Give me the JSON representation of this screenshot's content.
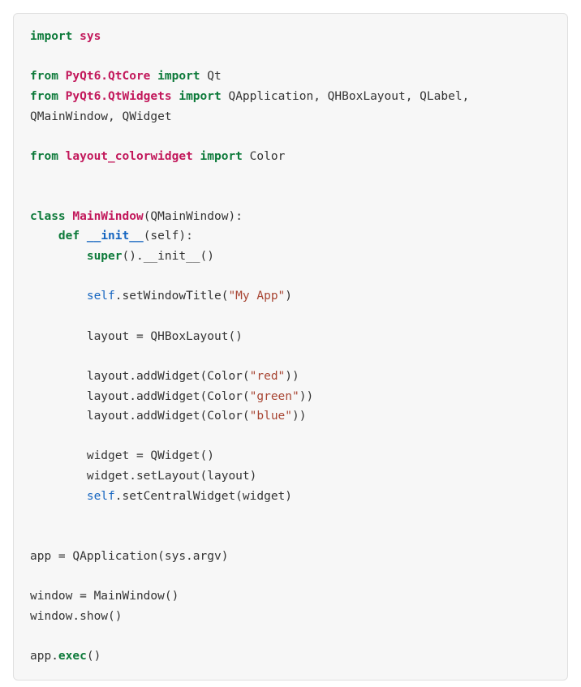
{
  "code": {
    "t01a": "import",
    "t01b": "sys",
    "t03a": "from",
    "t03b": "PyQt6.QtCore",
    "t03c": "import",
    "t03d": "Qt",
    "t04a": "from",
    "t04b": "PyQt6.QtWidgets",
    "t04c": "import",
    "t04d": "QApplication, QHBoxLayout, QLabel,",
    "t05a": "QMainWindow, QWidget",
    "t07a": "from",
    "t07b": "layout_colorwidget",
    "t07c": "import",
    "t07d": "Color",
    "t10a": "class",
    "t10b": "MainWindow",
    "t10c": "(QMainWindow):",
    "t11a": "def",
    "t11b": "__init__",
    "t11c": "(self):",
    "t12a": "super",
    "t12b": "().__init__()",
    "t14a": "self",
    "t14b": ".setWindowTitle(",
    "t14c": "\"My App\"",
    "t14d": ")",
    "t16a": "layout = QHBoxLayout()",
    "t18a": "layout.addWidget(Color(",
    "t18b": "\"red\"",
    "t18c": "))",
    "t19a": "layout.addWidget(Color(",
    "t19b": "\"green\"",
    "t19c": "))",
    "t20a": "layout.addWidget(Color(",
    "t20b": "\"blue\"",
    "t20c": "))",
    "t22a": "widget = QWidget()",
    "t23a": "widget.setLayout(layout)",
    "t24a": "self",
    "t24b": ".setCentralWidget(widget)",
    "t27a": "app = QApplication(sys.argv)",
    "t29a": "window = MainWindow()",
    "t30a": "window.show()",
    "t32a": "app.",
    "t32b": "exec",
    "t32c": "()"
  }
}
